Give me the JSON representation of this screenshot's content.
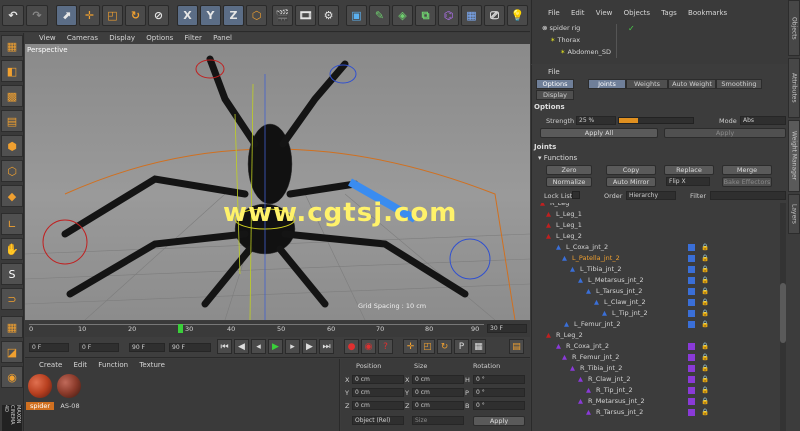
{
  "toolbar": {
    "axis_x": "X",
    "axis_y": "Y",
    "axis_z": "Z"
  },
  "viewport": {
    "menu": [
      "View",
      "Cameras",
      "Display",
      "Options",
      "Filter",
      "Panel"
    ],
    "label": "Perspective",
    "grid_spacing": "Grid Spacing : 10 cm",
    "watermark": "www.cgtsj.com"
  },
  "timeline": {
    "ticks": [
      "0",
      "10",
      "20",
      "30",
      "40",
      "50",
      "60",
      "70",
      "80",
      "90"
    ],
    "current_frame_marker": "30",
    "end_frame": "30 F",
    "start_field": "0 F",
    "min_field": "0 F",
    "max_field": "90 F",
    "end_field": "90 F"
  },
  "material_manager": {
    "menu": [
      "Create",
      "Edit",
      "Function",
      "Texture"
    ],
    "materials": [
      {
        "name": "spider",
        "color": "#b84020"
      },
      {
        "name": "AS-08",
        "color": "#8a3a2a"
      }
    ]
  },
  "coordinates": {
    "headers": [
      "Position",
      "Size",
      "Rotation"
    ],
    "rows": [
      {
        "axis": "X",
        "pos": "0 cm",
        "size_axis": "X",
        "size": "0 cm",
        "rot_axis": "H",
        "rot": "0 °"
      },
      {
        "axis": "Y",
        "pos": "0 cm",
        "size_axis": "Y",
        "size": "0 cm",
        "rot_axis": "P",
        "rot": "0 °"
      },
      {
        "axis": "Z",
        "pos": "0 cm",
        "size_axis": "Z",
        "size": "0 cm",
        "rot_axis": "B",
        "rot": "0 °"
      }
    ],
    "mode": "Object (Rel)",
    "size_mode": "Size",
    "apply": "Apply"
  },
  "object_manager": {
    "menu": [
      "File",
      "Edit",
      "View",
      "Objects",
      "Tags",
      "Bookmarks"
    ],
    "items": [
      "spider rig",
      "Thorax",
      "Abdomen_SD"
    ]
  },
  "attributes": {
    "menu": "File",
    "tabs": [
      "Options",
      "Joints",
      "Weights",
      "Auto Weight",
      "Smoothing",
      "Display"
    ],
    "options_title": "Options",
    "strength_label": "Strength",
    "strength_value": "25 %",
    "strength_fraction": 0.25,
    "mode_label": "Mode",
    "mode_value": "Abs",
    "apply_all": "Apply All",
    "apply": "Apply",
    "joints_title": "Joints",
    "functions_title": "Functions",
    "func_buttons": [
      "Zero",
      "Copy",
      "Replace",
      "Merge",
      "Normalize",
      "Auto Mirror",
      "Flip X",
      "Bake Effectors"
    ],
    "lock_list": "Lock List",
    "order_label": "Order",
    "order_value": "Hierarchy",
    "filter_label": "Filter",
    "joints": [
      {
        "name": "R_Leg",
        "color": ""
      },
      {
        "name": "L_Leg_1",
        "color": ""
      },
      {
        "name": "L_Leg_1",
        "color": ""
      },
      {
        "name": "L_Leg_2",
        "color": ""
      },
      {
        "name": "L_Coxa_jnt_2",
        "color": "#3a6fd8"
      },
      {
        "name": "L_Patella_jnt_2",
        "color": "#3a6fd8"
      },
      {
        "name": "L_Tibia_jnt_2",
        "color": "#3a6fd8"
      },
      {
        "name": "L_Metarsus_jnt_2",
        "color": "#3a6fd8"
      },
      {
        "name": "L_Tarsus_jnt_2",
        "color": "#3a6fd8"
      },
      {
        "name": "L_Claw_jnt_2",
        "color": "#3a6fd8"
      },
      {
        "name": "L_Tip_jnt_2",
        "color": "#3a6fd8"
      },
      {
        "name": "L_Femur_jnt_2",
        "color": "#3a6fd8"
      },
      {
        "name": "R_Leg_2",
        "color": ""
      },
      {
        "name": "R_Coxa_jnt_2",
        "color": "#8a3ad8"
      },
      {
        "name": "R_Femur_jnt_2",
        "color": "#8a3ad8"
      },
      {
        "name": "R_Tibia_jnt_2",
        "color": "#8a3ad8"
      },
      {
        "name": "R_Claw_jnt_2",
        "color": "#8a3ad8"
      },
      {
        "name": "R_Tip_jnt_2",
        "color": "#8a3ad8"
      },
      {
        "name": "R_Metarsus_jnt_2",
        "color": "#8a3ad8"
      },
      {
        "name": "R_Tarsus_jnt_2",
        "color": "#8a3ad8"
      }
    ]
  },
  "right_tabs": [
    "Objects",
    "Attributes",
    "Weight Manager",
    "Layers"
  ],
  "brand": "MAXON CINEMA 4D"
}
